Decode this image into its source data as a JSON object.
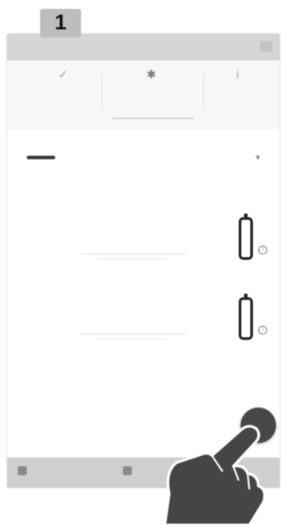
{
  "step": {
    "number": "1"
  },
  "tabs": [
    {
      "icon": "stats-icon",
      "label": "",
      "glyph": "✓",
      "active": false
    },
    {
      "icon": "settings-icon",
      "label": "",
      "glyph": "✱",
      "active": true
    },
    {
      "icon": "info-icon",
      "label": "",
      "glyph": "i",
      "active": false
    }
  ],
  "add_bar": {
    "label": ""
  },
  "device": {
    "name": "",
    "subtitle": "",
    "caret": "▾"
  },
  "list_items": [
    {
      "battery_icon": "battery-icon",
      "badge": "i"
    },
    {
      "battery_icon": "battery-icon",
      "badge": "i"
    }
  ],
  "bottom_nav": [
    {
      "label": ""
    },
    {
      "label": ""
    },
    {
      "label": ""
    }
  ],
  "colors": {
    "statusbar": "#d5d5d5",
    "fab": "#474747",
    "bottombar": "#cfcfcf",
    "battery": "#232323"
  }
}
